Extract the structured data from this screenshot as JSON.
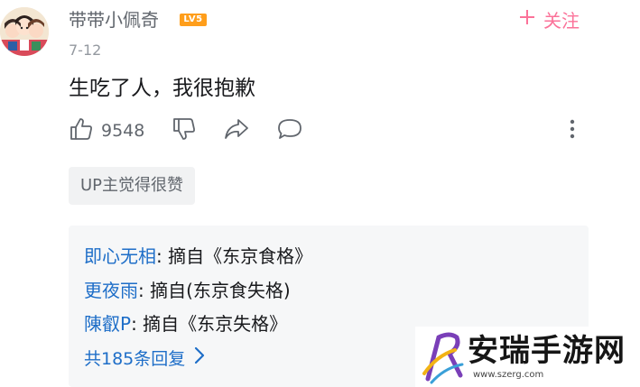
{
  "comment": {
    "user": {
      "name": "带带小佩奇",
      "level": "LV5"
    },
    "follow_label": "关注",
    "follow_icon": "plus-icon",
    "date": "7-12",
    "content": "生吃了人，我很抱歉",
    "actions": {
      "like_count": "9548",
      "like_icon": "thumbs-up-icon",
      "dislike_icon": "thumbs-down-icon",
      "share_icon": "share-icon",
      "reply_icon": "comment-bubble-icon",
      "more_icon": "more-vertical-icon"
    },
    "tag": "UP主觉得很赞"
  },
  "replies": {
    "items": [
      {
        "user": "即心无相",
        "text": ": 摘自《东京食格》"
      },
      {
        "user": "更夜雨",
        "text": ": 摘自(东京食失格)"
      },
      {
        "user": "陳叡P",
        "text": ": 摘自《东京失格》"
      }
    ],
    "total_label": "共185条回复"
  },
  "watermark": {
    "text": "安瑞手游网",
    "url": "www.szerg.com"
  },
  "colors": {
    "accent_pink": "#fb7299",
    "link_blue": "#1e6ec8",
    "level_orange": "#ff9e1b",
    "secondary_text": "#61666d"
  }
}
